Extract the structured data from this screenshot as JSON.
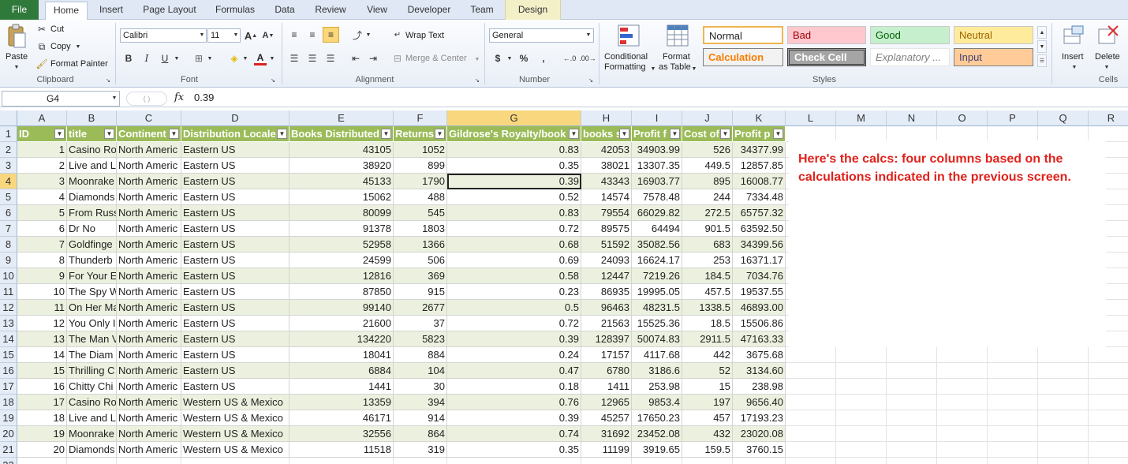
{
  "tabs": {
    "file": "File",
    "home": "Home",
    "insert": "Insert",
    "page_layout": "Page Layout",
    "formulas": "Formulas",
    "data": "Data",
    "review": "Review",
    "view": "View",
    "developer": "Developer",
    "team": "Team",
    "design": "Design"
  },
  "clipboard": {
    "paste": "Paste",
    "cut": "Cut",
    "copy": "Copy",
    "format_painter": "Format Painter",
    "label": "Clipboard"
  },
  "font": {
    "name": "Calibri",
    "size": "11",
    "bold": "B",
    "italic": "I",
    "underline": "U",
    "label": "Font"
  },
  "alignment": {
    "wrap_text": "Wrap Text",
    "merge_center": "Merge & Center",
    "label": "Alignment"
  },
  "number": {
    "format": "General",
    "currency": "$",
    "percent": "%",
    "comma": ",",
    "label": "Number"
  },
  "styles": {
    "conditional": "Conditional",
    "formatting": "Formatting",
    "format": "Format",
    "as_table": "as Table",
    "normal": "Normal",
    "bad": "Bad",
    "good": "Good",
    "neutral": "Neutral",
    "calculation": "Calculation",
    "check_cell": "Check Cell",
    "explanatory": "Explanatory ...",
    "input": "Input",
    "label": "Styles"
  },
  "cells_group": {
    "insert": "Insert",
    "delete": "Delete",
    "label": "Cells"
  },
  "formula_bar": {
    "name_box": "G4",
    "fx": "fx",
    "value": "0.39"
  },
  "columns": [
    "A",
    "B",
    "C",
    "D",
    "E",
    "F",
    "G",
    "H",
    "I",
    "J",
    "K",
    "L",
    "M",
    "N",
    "O",
    "P",
    "Q",
    "R"
  ],
  "header": [
    "ID",
    "title",
    "Continent",
    "Distribution Locale",
    "Books Distributed",
    "Returns",
    "Gildrose's Royalty/book",
    "books s",
    "Profit f",
    "Cost of",
    "Profit p"
  ],
  "rows": [
    [
      "1",
      "Casino Ro",
      "North Americ",
      "Eastern US",
      "43105",
      "1052",
      "0.83",
      "42053",
      "34903.99",
      "526",
      "34377.99"
    ],
    [
      "2",
      "Live and L",
      "North Americ",
      "Eastern US",
      "38920",
      "899",
      "0.35",
      "38021",
      "13307.35",
      "449.5",
      "12857.85"
    ],
    [
      "3",
      "Moonrake",
      "North Americ",
      "Eastern US",
      "45133",
      "1790",
      "0.39",
      "43343",
      "16903.77",
      "895",
      "16008.77"
    ],
    [
      "4",
      "Diamonds",
      "North Americ",
      "Eastern US",
      "15062",
      "488",
      "0.52",
      "14574",
      "7578.48",
      "244",
      "7334.48"
    ],
    [
      "5",
      "From Russ",
      "North Americ",
      "Eastern US",
      "80099",
      "545",
      "0.83",
      "79554",
      "66029.82",
      "272.5",
      "65757.32"
    ],
    [
      "6",
      "Dr No",
      "North Americ",
      "Eastern US",
      "91378",
      "1803",
      "0.72",
      "89575",
      "64494",
      "901.5",
      "63592.50"
    ],
    [
      "7",
      "Goldfinge",
      "North Americ",
      "Eastern US",
      "52958",
      "1366",
      "0.68",
      "51592",
      "35082.56",
      "683",
      "34399.56"
    ],
    [
      "8",
      "Thunderb",
      "North Americ",
      "Eastern US",
      "24599",
      "506",
      "0.69",
      "24093",
      "16624.17",
      "253",
      "16371.17"
    ],
    [
      "9",
      "For Your E",
      "North Americ",
      "Eastern US",
      "12816",
      "369",
      "0.58",
      "12447",
      "7219.26",
      "184.5",
      "7034.76"
    ],
    [
      "10",
      "The Spy W",
      "North Americ",
      "Eastern US",
      "87850",
      "915",
      "0.23",
      "86935",
      "19995.05",
      "457.5",
      "19537.55"
    ],
    [
      "11",
      "On Her Ma",
      "North Americ",
      "Eastern US",
      "99140",
      "2677",
      "0.5",
      "96463",
      "48231.5",
      "1338.5",
      "46893.00"
    ],
    [
      "12",
      "You Only I",
      "North Americ",
      "Eastern US",
      "21600",
      "37",
      "0.72",
      "21563",
      "15525.36",
      "18.5",
      "15506.86"
    ],
    [
      "13",
      "The Man V",
      "North Americ",
      "Eastern US",
      "134220",
      "5823",
      "0.39",
      "128397",
      "50074.83",
      "2911.5",
      "47163.33"
    ],
    [
      "14",
      "The Diam",
      "North Americ",
      "Eastern US",
      "18041",
      "884",
      "0.24",
      "17157",
      "4117.68",
      "442",
      "3675.68"
    ],
    [
      "15",
      "Thrilling C",
      "North Americ",
      "Eastern US",
      "6884",
      "104",
      "0.47",
      "6780",
      "3186.6",
      "52",
      "3134.60"
    ],
    [
      "16",
      "Chitty Chi",
      "North Americ",
      "Eastern US",
      "1441",
      "30",
      "0.18",
      "1411",
      "253.98",
      "15",
      "238.98"
    ],
    [
      "17",
      "Casino Ro",
      "North Americ",
      "Western US & Mexico",
      "13359",
      "394",
      "0.76",
      "12965",
      "9853.4",
      "197",
      "9656.40"
    ],
    [
      "18",
      "Live and L",
      "North Americ",
      "Western US & Mexico",
      "46171",
      "914",
      "0.39",
      "45257",
      "17650.23",
      "457",
      "17193.23"
    ],
    [
      "19",
      "Moonrake",
      "North Americ",
      "Western US & Mexico",
      "32556",
      "864",
      "0.74",
      "31692",
      "23452.08",
      "432",
      "23020.08"
    ],
    [
      "20",
      "Diamonds",
      "North Americ",
      "Western US & Mexico",
      "11518",
      "319",
      "0.35",
      "11199",
      "3919.65",
      "159.5",
      "3760.15"
    ]
  ],
  "note": "Here's the calcs: four columns based on the calculations indicated in the previous screen.",
  "colors": {
    "header_green": "#9bbb59",
    "band": "#ebf1de",
    "note_red": "#e0221c",
    "file_tab": "#2f7a3a"
  }
}
